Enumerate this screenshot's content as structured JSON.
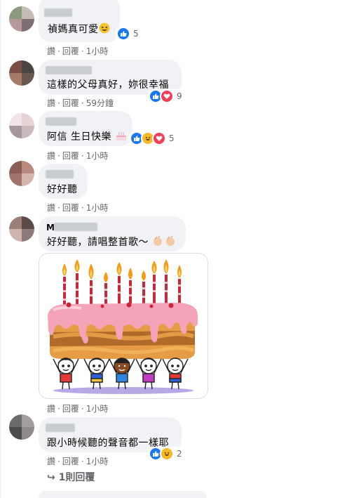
{
  "colors": {
    "bubble": "#f0f2f5",
    "meta": "#65676b",
    "like": "#1877f2",
    "love": "#f33e58",
    "haha": "#f7b928"
  },
  "comments": [
    {
      "text": "禎媽真可愛",
      "inline_emoji": "grinning-squint-face",
      "actions": {
        "like": "讚",
        "reply": "回覆",
        "time": "1小時"
      },
      "reactions": {
        "icons": [
          "like-icon"
        ],
        "count": "5"
      }
    },
    {
      "text": "這樣的父母真好，妳很幸福",
      "actions": {
        "like": "讚",
        "reply": "回覆",
        "time": "59分鐘"
      },
      "reactions": {
        "icons": [
          "like-icon",
          "love-icon"
        ],
        "count": "9"
      }
    },
    {
      "text": "阿信 生日快樂",
      "inline_emoji": "birthday-cake",
      "actions": {
        "like": "讚",
        "reply": "回覆",
        "time": "1小時"
      },
      "reactions": {
        "icons": [
          "like-icon",
          "haha-icon",
          "love-icon"
        ],
        "count": "5"
      }
    },
    {
      "text": "好好聽",
      "actions": {
        "like": "讚",
        "reply": "回覆",
        "time": "1小時"
      }
    },
    {
      "name_initial": "M",
      "text": "好好聽，請唱整首歌～",
      "inline_emoji": "clapping-hands",
      "sticker": "birthday-cake-sticker",
      "actions": {
        "like": "讚",
        "reply": "回覆",
        "time": "1小時"
      }
    },
    {
      "text": "跟小時候聽的聲音都一樣耶",
      "actions": {
        "like": "讚",
        "reply": "回覆",
        "time": "1小時"
      },
      "reactions": {
        "icons": [
          "like-icon",
          "haha-icon"
        ],
        "count": "2"
      }
    }
  ],
  "replies_link": {
    "arrow": "↪",
    "label": "1則回覆"
  }
}
